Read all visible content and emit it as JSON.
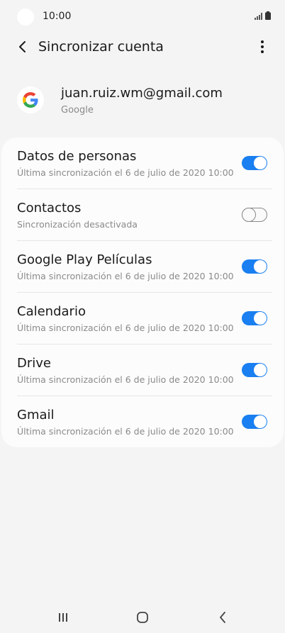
{
  "status_bar": {
    "time": "10:00"
  },
  "header": {
    "title": "Sincronizar cuenta"
  },
  "account": {
    "email": "juan.ruiz.wm@gmail.com",
    "type": "Google"
  },
  "sync_items": [
    {
      "title": "Datos de personas",
      "subtitle": "Última sincronización el 6 de julio de 2020 10:00",
      "enabled": true
    },
    {
      "title": "Contactos",
      "subtitle": "Sincronización desactivada",
      "enabled": false
    },
    {
      "title": "Google Play Películas",
      "subtitle": "Última sincronización el 6 de julio de 2020 10:00",
      "enabled": true
    },
    {
      "title": "Calendario",
      "subtitle": "Última sincronización el 6 de julio de 2020 10:00",
      "enabled": true
    },
    {
      "title": "Drive",
      "subtitle": "Última sincronización el 6 de julio de 2020 10:00",
      "enabled": true
    },
    {
      "title": "Gmail",
      "subtitle": "Última sincronización el 6 de julio de 2020 10:00",
      "enabled": true
    }
  ],
  "colors": {
    "accent": "#1a7ff0",
    "background": "#f4f4f4",
    "card": "#fcfcfc"
  },
  "icons": {
    "back": "chevron-left-icon",
    "more": "more-vertical-icon",
    "logo": "google-logo",
    "nav_recents": "recent-apps-icon",
    "nav_home": "home-icon",
    "nav_back": "back-icon"
  }
}
